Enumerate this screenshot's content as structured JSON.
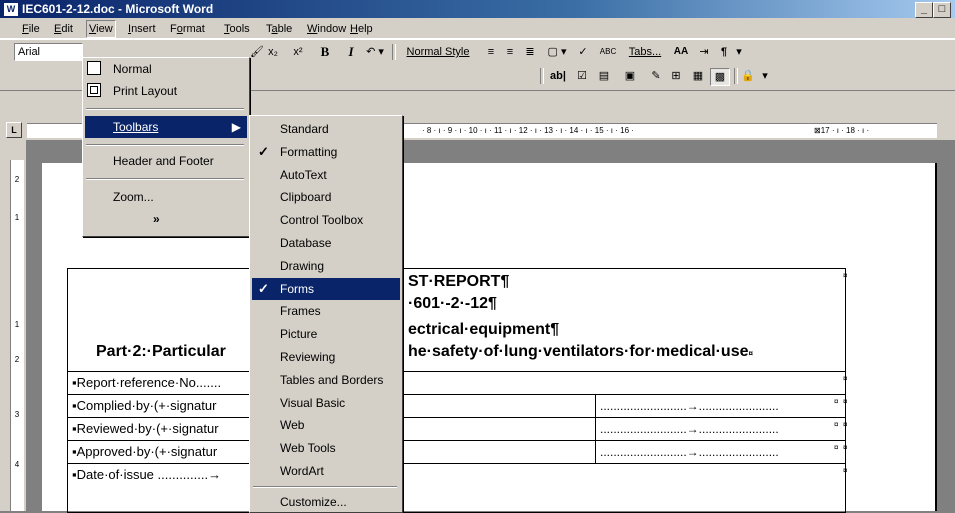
{
  "window": {
    "title": "IEC601-2-12.doc - Microsoft Word"
  },
  "menubar": [
    "File",
    "Edit",
    "View",
    "Insert",
    "Format",
    "Tools",
    "Table",
    "Window",
    "Help"
  ],
  "toolbar_format": {
    "font": "Arial",
    "style_label": "Normal Style",
    "tabs_label": "Tabs...",
    "abc_label": "ABC"
  },
  "view_menu": {
    "items": [
      {
        "label": "Normal",
        "icon": "normal-view-icon"
      },
      {
        "label": "Print Layout",
        "icon": "print-layout-icon"
      },
      {
        "label": "Toolbars",
        "submenu": true,
        "highlighted": true
      },
      {
        "label": "Header and Footer"
      },
      {
        "label": "Zoom..."
      }
    ],
    "expand_glyph": "»"
  },
  "toolbars_menu": {
    "items": [
      {
        "label": "Standard",
        "checked": false
      },
      {
        "label": "Formatting",
        "checked": true
      },
      {
        "label": "AutoText",
        "checked": false
      },
      {
        "label": "Clipboard",
        "checked": false
      },
      {
        "label": "Control Toolbox",
        "checked": false
      },
      {
        "label": "Database",
        "checked": false
      },
      {
        "label": "Drawing",
        "checked": false
      },
      {
        "label": "Forms",
        "checked": true,
        "highlighted": true
      },
      {
        "label": "Frames",
        "checked": false
      },
      {
        "label": "Picture",
        "checked": false
      },
      {
        "label": "Reviewing",
        "checked": false
      },
      {
        "label": "Tables and Borders",
        "checked": false
      },
      {
        "label": "Visual Basic",
        "checked": false
      },
      {
        "label": "Web",
        "checked": false
      },
      {
        "label": "Web Tools",
        "checked": false
      },
      {
        "label": "WordArt",
        "checked": false
      },
      {
        "label": "Customize...",
        "checked": false
      }
    ]
  },
  "ruler": {
    "marks": "· 8 · ı · 9 · ı · 10 · ı · 11 · ı · 12 · ı · 13 · ı · 14 · ı · 15 · ı · 16 · ",
    "marks_tail": "17 · ı · 18 · ı ·"
  },
  "vruler_numbers": [
    "2",
    "1",
    "1",
    "2",
    "3",
    "4"
  ],
  "document": {
    "header_line1": "ST·REPORT¶",
    "header_line2": "·601·-2·-12¶",
    "header_line3": "ectrical·equipment¶",
    "header_line4_left": "Part·2:·Particular",
    "header_line4_right": "he·safety·of·lung·ventilators·for·medical·use",
    "cell_mark": "¤",
    "rows": [
      {
        "label": "▪Report·reference·No.......",
        "dots": ""
      },
      {
        "label": "▪Complied·by·(+·signatur",
        "dots": "..........................→........................"
      },
      {
        "label": "▪Reviewed·by·(+·signatur",
        "dots": "..........................→........................"
      },
      {
        "label": "▪Approved·by·(+·signatur",
        "dots": "..........................→........................"
      },
      {
        "label": "▪Date·of·issue ..............→",
        "dots": ""
      }
    ]
  }
}
